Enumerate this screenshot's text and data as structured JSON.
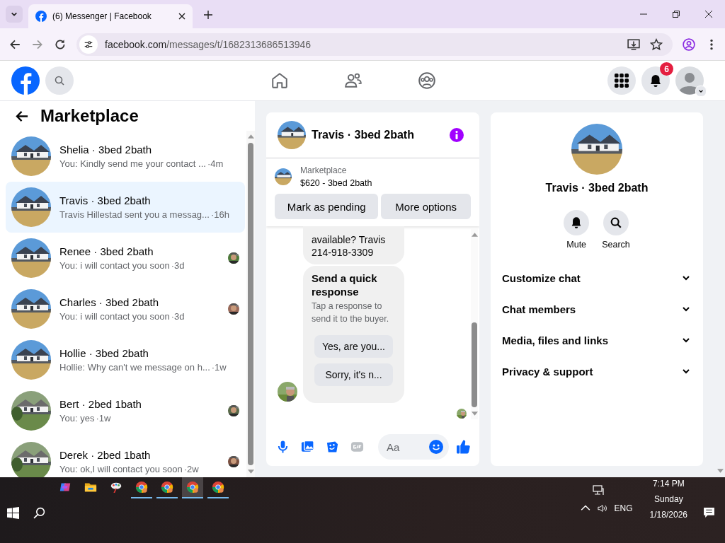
{
  "browser": {
    "tab_title": "(6) Messenger | Facebook",
    "url_domain": "facebook.com",
    "url_path": "/messages/t/1682313686513946"
  },
  "header": {
    "notification_count": "6"
  },
  "sidebar": {
    "title": "Marketplace",
    "conversations": [
      {
        "name": "Shelia · 3bed 2bath",
        "preview": "You: Kindly send me your contact ...",
        "time": "·4m",
        "selected": false,
        "seen": false
      },
      {
        "name": "Travis · 3bed 2bath",
        "preview": "Travis Hillestad sent you a messag...",
        "time": "·16h",
        "selected": true,
        "seen": false
      },
      {
        "name": "Renee · 3bed 2bath",
        "preview": "You: i will contact you soon",
        "time": "·3d",
        "selected": false,
        "seen": true
      },
      {
        "name": "Charles · 3bed 2bath",
        "preview": "You: i will contact you soon",
        "time": "·3d",
        "selected": false,
        "seen": true
      },
      {
        "name": "Hollie · 3bed 2bath",
        "preview": "Hollie: Why can't we message on h...",
        "time": "·1w",
        "selected": false,
        "seen": false
      },
      {
        "name": "Bert · 2bed 1bath",
        "preview": "You: yes",
        "time": "·1w",
        "selected": false,
        "seen": true
      },
      {
        "name": "Derek · 2bed 1bath",
        "preview": "You: ok,I will contact you soon",
        "time": "·2w",
        "selected": false,
        "seen": true
      }
    ]
  },
  "chat": {
    "title": "Travis · 3bed 2bath",
    "listing": {
      "label": "Marketplace",
      "title": "$620 - 3bed 2bath"
    },
    "actions": [
      "Mark as pending",
      "More options"
    ],
    "messages": [
      {
        "kind": "text",
        "lines": [
          "available? Travis",
          "214-918-3309"
        ]
      },
      {
        "kind": "quick_response",
        "title": "Send a quick response",
        "subtitle": "Tap a response to send it to the buyer.",
        "options": [
          "Yes, are you...",
          "Sorry, it's n..."
        ]
      }
    ],
    "composer": {
      "placeholder": "Aa"
    }
  },
  "details": {
    "title": "Travis · 3bed 2bath",
    "actions": [
      {
        "kind": "mute",
        "label": "Mute"
      },
      {
        "kind": "search",
        "label": "Search"
      }
    ],
    "sections": [
      {
        "label": "Customize chat",
        "expanded": false
      },
      {
        "label": "Chat members",
        "expanded": false
      },
      {
        "label": "Media, files and links",
        "expanded": false
      },
      {
        "label": "Privacy & support",
        "expanded": false
      }
    ]
  },
  "taskbar": {
    "apps": [
      {
        "kind": "copilot",
        "running": false,
        "selected": false
      },
      {
        "kind": "folder",
        "running": false,
        "selected": false
      },
      {
        "kind": "paint",
        "running": false,
        "selected": false
      },
      {
        "kind": "chrome",
        "running": true,
        "selected": false
      },
      {
        "kind": "chrome",
        "running": true,
        "selected": false
      },
      {
        "kind": "chrome",
        "running": true,
        "selected": true
      },
      {
        "kind": "chrome",
        "running": true,
        "selected": false
      }
    ],
    "language": "ENG",
    "time": "7:14 PM",
    "day": "Sunday",
    "date": "1/18/2026"
  }
}
